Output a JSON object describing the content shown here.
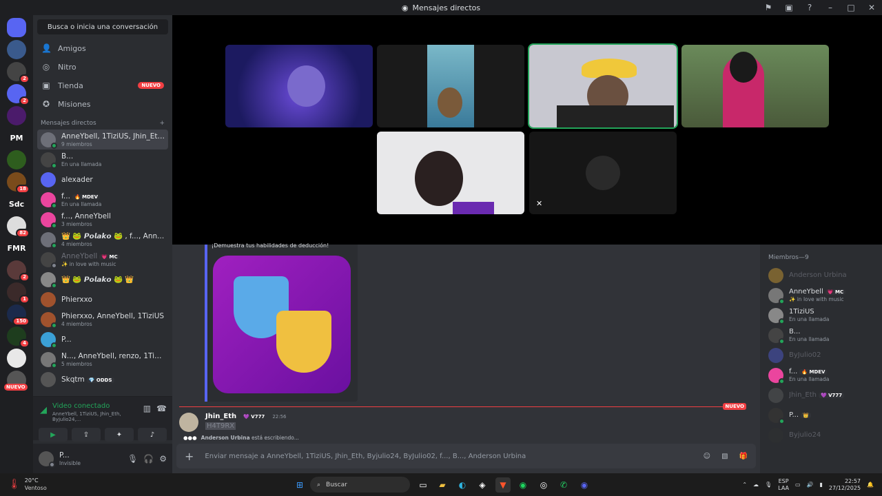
{
  "window": {
    "title": "Mensajes directos",
    "controls": [
      "inbox-icon",
      "screen-icon",
      "help-icon",
      "minimize-icon",
      "maximize-icon",
      "close-icon"
    ]
  },
  "guilds": [
    {
      "label": "",
      "color": "#5865f2",
      "badge": ""
    },
    {
      "label": "",
      "color": "#3a5a8c",
      "badge": ""
    },
    {
      "label": "",
      "color": "#444",
      "badge": "2"
    },
    {
      "label": "",
      "color": "#5865f2",
      "badge": "2"
    },
    {
      "label": "",
      "color": "#4b1b6b",
      "badge": ""
    },
    {
      "label": "PM",
      "color": "#1e1f22",
      "badge": ""
    },
    {
      "label": "",
      "color": "#2e5d1e",
      "badge": ""
    },
    {
      "label": "",
      "color": "#7a4b1b",
      "badge": "18"
    },
    {
      "label": "Sdc",
      "color": "#1e1f22",
      "badge": ""
    },
    {
      "label": "",
      "color": "#dddddd",
      "badge": "82"
    },
    {
      "label": "FMR",
      "color": "#1e1f22",
      "badge": ""
    },
    {
      "label": "",
      "color": "#5a3a3a",
      "badge": "2"
    },
    {
      "label": "",
      "color": "#3b2a2a",
      "badge": "1"
    },
    {
      "label": "",
      "color": "#1b2a4b",
      "badge": "150"
    },
    {
      "label": "",
      "color": "#1e3d1e",
      "badge": "4"
    },
    {
      "label": "",
      "color": "#e8e8e8",
      "badge": ""
    },
    {
      "label": "",
      "color": "#555",
      "badge": ""
    }
  ],
  "guild_new": "NUEVO",
  "sidebar": {
    "search": "Busca o inicia una conversación",
    "nav": [
      {
        "label": "Amigos",
        "icon": "friends-icon",
        "glyph": "👤"
      },
      {
        "label": "Nitro",
        "icon": "nitro-icon",
        "glyph": "◎"
      },
      {
        "label": "Tienda",
        "icon": "shop-icon",
        "glyph": "▣",
        "badge": "NUEVO"
      },
      {
        "label": "Misiones",
        "icon": "quests-icon",
        "glyph": "✪"
      }
    ],
    "dm_header": "Mensajes directos",
    "dm_add": "+",
    "dms": [
      {
        "name": "AnneYbell, 1TiziUS, Jhin_Eth, ...",
        "sub": "9 miembros",
        "color": "#6d6f78",
        "status": "online",
        "selected": true
      },
      {
        "name": "B...",
        "sub": "En una llamada",
        "color": "#444",
        "status": "online"
      },
      {
        "name": "alexader",
        "sub": "",
        "color": "#5865f2",
        "status": ""
      },
      {
        "name": "f...",
        "tag": "🔥 MDEV",
        "sub": "En una llamada",
        "color": "#eb459e",
        "status": "online"
      },
      {
        "name": "f..., AnneYbell",
        "sub": "3 miembros",
        "color": "#eb459e",
        "status": "online"
      },
      {
        "name": "👑 🐸 𝙋𝙤𝙡𝙖𝙠𝙤 🐸 , f..., Ann...",
        "sub": "4 miembros",
        "color": "#6d6f78",
        "status": "online"
      },
      {
        "name": "AnneYbell",
        "tag": "💗 MC",
        "sub": "✨ in love with music",
        "color": "#444",
        "status": "idle",
        "dim": true
      },
      {
        "name": "👑 🐸 𝙋𝙤𝙡𝙖𝙠𝙤 🐸 👑",
        "sub": "",
        "color": "#888",
        "status": "online"
      },
      {
        "name": "Phierxxo",
        "sub": "",
        "color": "#a0522d",
        "status": ""
      },
      {
        "name": "Phierxxo, AnneYbell, 1TiziUS",
        "sub": "4 miembros",
        "color": "#a0522d",
        "status": "online"
      },
      {
        "name": "P...",
        "sub": "",
        "color": "#3ba0d6",
        "status": "online"
      },
      {
        "name": "N..., AnneYbell, renzo, 1TiziUS",
        "sub": "5 miembros",
        "color": "#777",
        "status": "online"
      },
      {
        "name": "Skqtm",
        "tag": "💎 ODDS",
        "sub": "",
        "color": "#555",
        "status": ""
      }
    ]
  },
  "voice": {
    "title": "Video conectado",
    "sub": "AnneYbell, 1TiziUS, Jhin_Eth, Byjulio24,...",
    "buttons": [
      {
        "icon": "camera-icon",
        "glyph": "▶"
      },
      {
        "icon": "screen-share-icon",
        "glyph": "⇪"
      },
      {
        "icon": "activities-icon",
        "glyph": "✦"
      },
      {
        "icon": "soundboard-icon",
        "glyph": "♪"
      }
    ]
  },
  "user": {
    "name": "P...",
    "status": "Invisible"
  },
  "chat": {
    "embed_text": "¡Demuestra tus habilidades de deducción!",
    "new_label": "NUEVO",
    "message": {
      "author": "Jhin_Eth",
      "tag": "💜 V777",
      "time": "22:56",
      "content": "H4T9RX"
    },
    "typing": "Anderson Urbina",
    "typing_suffix": "está escribiendo...",
    "input_placeholder": "Enviar mensaje a AnneYbell, 1TiziUS, Jhin_Eth, Byjulio24, ByJulio02, f..., B..., Anderson Urbina"
  },
  "members": {
    "header": "Miembros—9",
    "list": [
      {
        "name": "Anderson Urbina",
        "sub": "",
        "color": "#f0b232",
        "dim": true
      },
      {
        "name": "AnneYbell",
        "tag": "💗 MC",
        "sub": "✨ in love with music",
        "color": "#777"
      },
      {
        "name": "1TiziUS",
        "sub": "En una llamada",
        "color": "#888"
      },
      {
        "name": "B...",
        "sub": "En una llamada",
        "color": "#444"
      },
      {
        "name": "ByJulio02",
        "sub": "",
        "color": "#5865f2",
        "dim": true
      },
      {
        "name": "f...",
        "tag": "🔥 MDEV",
        "sub": "En una llamada",
        "color": "#eb459e"
      },
      {
        "name": "Jhin_Eth",
        "tag": "💜 V777",
        "sub": "",
        "color": "#666",
        "dim": true
      },
      {
        "name": "P...",
        "tag": "👑",
        "sub": "",
        "color": "#333"
      },
      {
        "name": "Byjulio24",
        "sub": "",
        "color": "#333",
        "dim": true
      }
    ]
  },
  "taskbar": {
    "weather_temp": "20°C",
    "weather_desc": "Ventoso",
    "search": "Buscar",
    "lang": "ESP",
    "lang2": "LAA",
    "time": "22:57",
    "date": "27/12/2025"
  }
}
